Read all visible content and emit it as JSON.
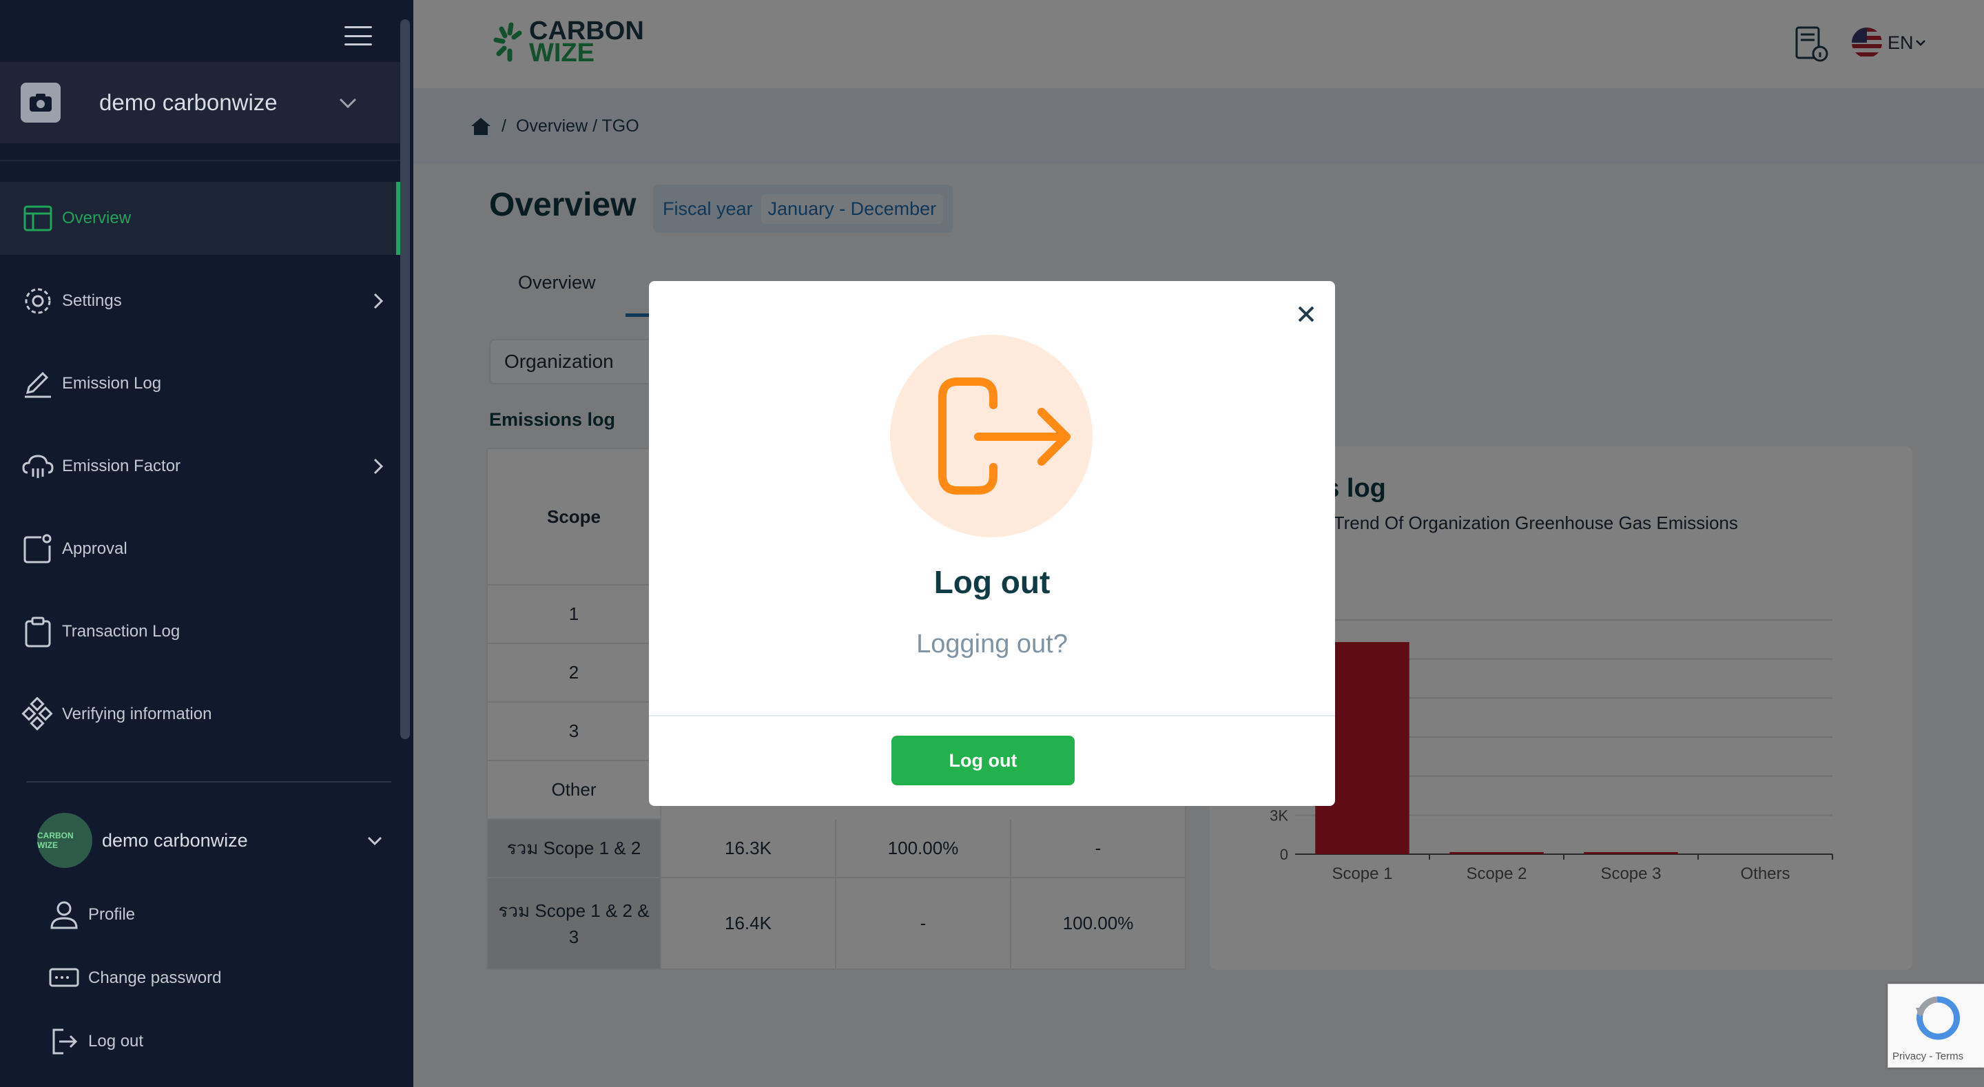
{
  "sidebar": {
    "org_name": "demo carbonwize",
    "items": [
      {
        "label": "Overview"
      },
      {
        "label": "Settings"
      },
      {
        "label": "Emission Log"
      },
      {
        "label": "Emission Factor"
      },
      {
        "label": "Approval"
      },
      {
        "label": "Transaction Log"
      },
      {
        "label": "Verifying information"
      }
    ],
    "user": {
      "name": "demo carbonwize",
      "avatar_text": "CARBON WIZE",
      "menu": [
        {
          "label": "Profile"
        },
        {
          "label": "Change password"
        },
        {
          "label": "Log out"
        }
      ]
    }
  },
  "header": {
    "logo_line1": "CARBON",
    "logo_line2": "WIZE",
    "language": "EN"
  },
  "breadcrumb": {
    "sep": "/",
    "path": "Overview / TGO"
  },
  "page": {
    "title": "Overview",
    "fiscal_label": "Fiscal year",
    "fiscal_value": "January - December",
    "tab_overview": "Overview",
    "org_button": "Organization",
    "section_label": "Emissions log"
  },
  "table": {
    "scope_header": "Scope",
    "rows": [
      {
        "scope": "1"
      },
      {
        "scope": "2"
      },
      {
        "scope": "3"
      },
      {
        "scope": "Other"
      },
      {
        "scope": "รวม Scope 1 & 2",
        "value": "16.3K",
        "pct12": "100.00%",
        "pct123": "-"
      },
      {
        "scope": "รวม Scope 1 & 2 & 3",
        "value": "16.4K",
        "pct12": "-",
        "pct123": "100.00%"
      }
    ]
  },
  "chart_card": {
    "title_visible": "ns log",
    "subtitle_visible": "nd Trend Of Organization Greenhouse Gas Emissions"
  },
  "chart_data": {
    "type": "bar",
    "categories": [
      "Scope 1",
      "Scope 2",
      "Scope 3",
      "Others"
    ],
    "values": [
      16300,
      50,
      80,
      0
    ],
    "y_ticks_visible": [
      "3K",
      "0"
    ],
    "ylim": [
      0,
      18000
    ],
    "grid": true,
    "bar_color": "#c0192b"
  },
  "modal": {
    "title": "Log out",
    "message": "Logging out?",
    "button": "Log out"
  },
  "recaptcha": {
    "links": "Privacy - Terms"
  },
  "colors": {
    "sidebar_bg": "#111a2c",
    "accent_green": "#22a35a",
    "logout_orange": "#ff8a14"
  }
}
